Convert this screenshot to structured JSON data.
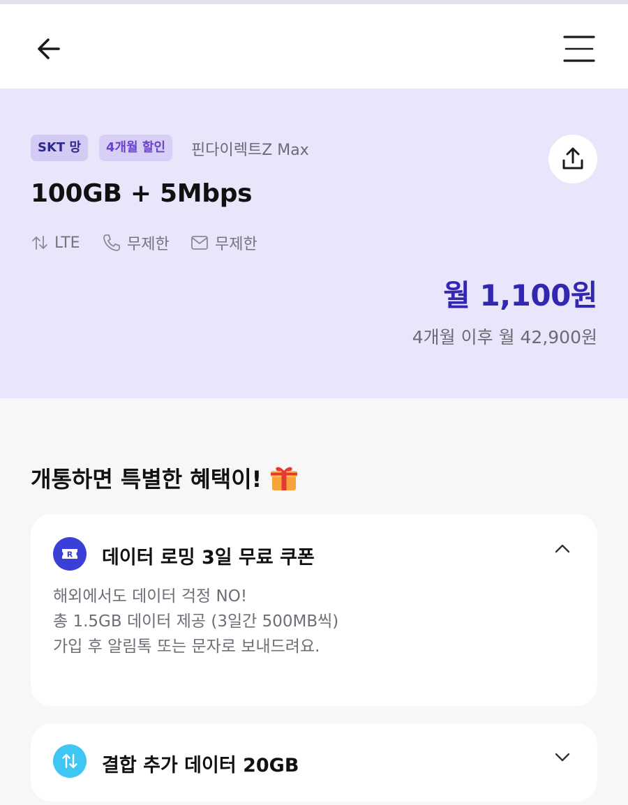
{
  "header": {
    "back_icon": "arrow-left-icon",
    "menu_icon": "menu-icon"
  },
  "plan": {
    "tags": [
      "SKT 망",
      "4개월 할인"
    ],
    "provider": "핀다이렉트Z Max",
    "title": "100GB + 5Mbps",
    "specs": {
      "network": "LTE",
      "call": "무제한",
      "sms": "무제한"
    },
    "price": "월 1,100원",
    "after_price": "4개월 이후 월 42,900원",
    "share_icon": "share-icon"
  },
  "benefits": {
    "title": "개통하면 특별한 혜택이!",
    "items": [
      {
        "title": "데이터 로밍 3일 무료 쿠폰",
        "lines": [
          "해외에서도 데이터 걱정 NO!",
          "총 1.5GB 데이터 제공 (3일간 500MB씩)",
          "가입 후 알림톡 또는 문자로 보내드려요."
        ],
        "expanded": true
      },
      {
        "title": "결합 추가 데이터 20GB",
        "expanded": false
      }
    ]
  },
  "colors": {
    "accent": "#3327b2",
    "plan_bg": "#e9e5fa",
    "coupon_icon": "#3a3fd8",
    "data_icon": "#3fc6f2"
  }
}
